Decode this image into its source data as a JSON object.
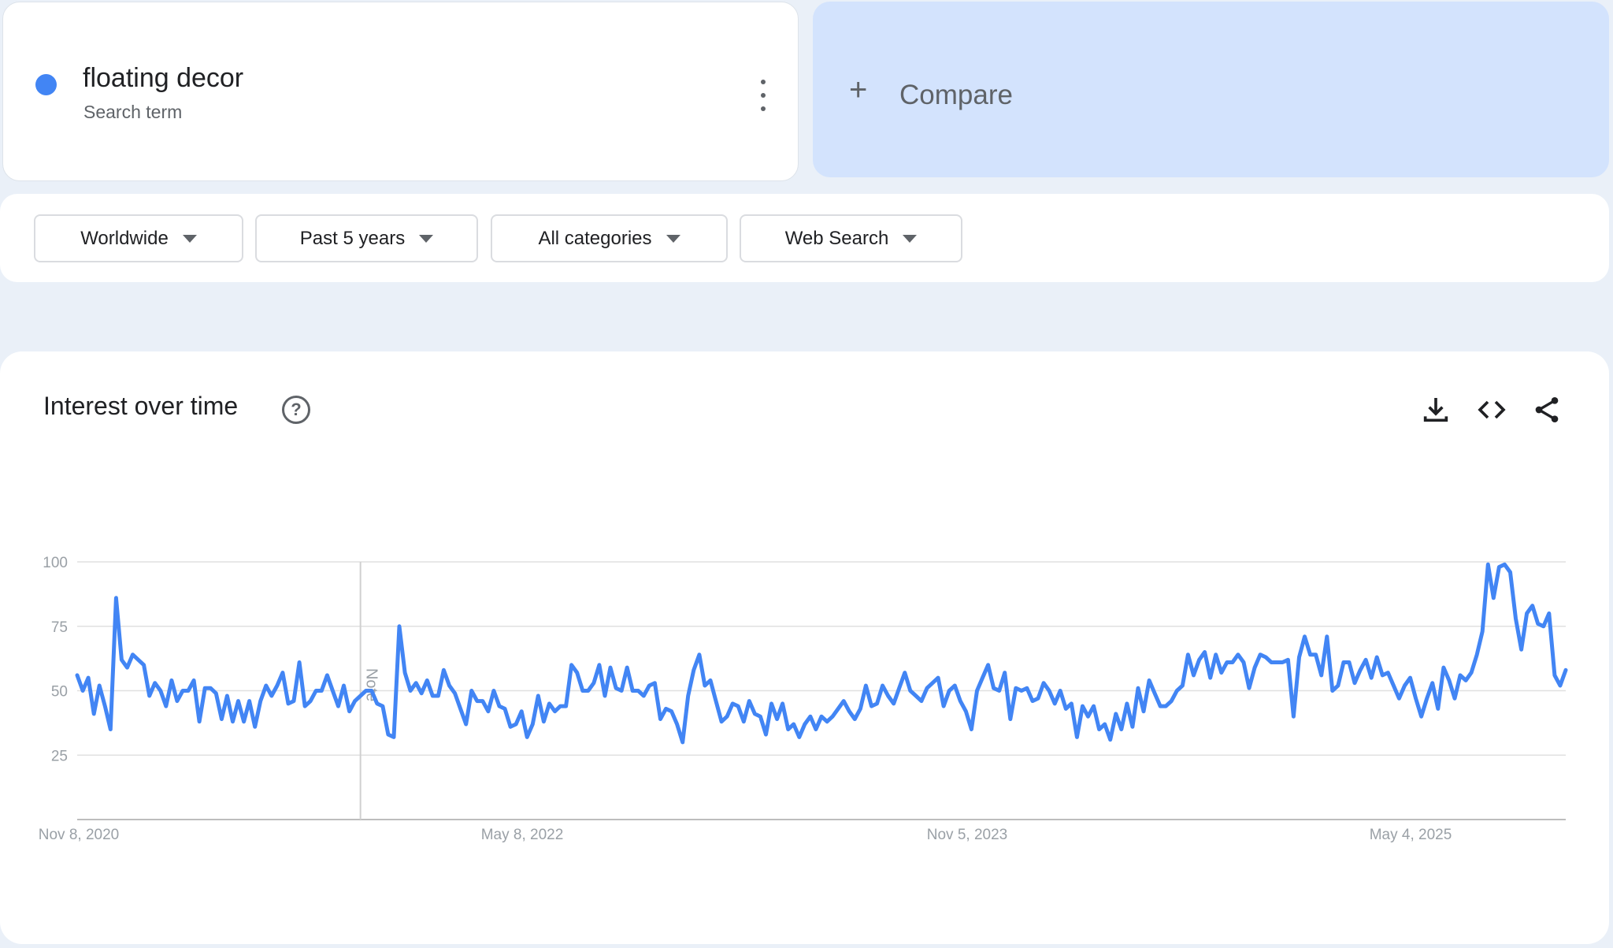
{
  "search_term": {
    "name": "floating decor",
    "subtitle": "Search term",
    "color": "#4285f4"
  },
  "compare": {
    "plus": "+",
    "label": "Compare"
  },
  "filters": [
    {
      "label": "Worldwide"
    },
    {
      "label": "Past 5 years"
    },
    {
      "label": "All categories"
    },
    {
      "label": "Web Search"
    }
  ],
  "chart": {
    "title": "Interest over time",
    "help_icon": "?",
    "actions": [
      "download-icon",
      "embed-code-icon",
      "share-icon"
    ],
    "note_label": "Note"
  },
  "chart_data": {
    "type": "line",
    "title": "Interest over time",
    "xlabel": "",
    "ylabel": "",
    "ylim": [
      0,
      100
    ],
    "yticks": [
      25,
      50,
      75,
      100
    ],
    "xticks": [
      "Nov 8, 2020",
      "May 8, 2022",
      "Nov 5, 2023",
      "May 4, 2025"
    ],
    "x_start": "Nov 8, 2020",
    "interval": "weekly",
    "note_index": 51,
    "grid": true,
    "line_color": "#4285f4",
    "series": [
      {
        "name": "floating decor",
        "values": [
          56,
          50,
          55,
          41,
          52,
          44,
          35,
          86,
          62,
          59,
          64,
          62,
          60,
          48,
          53,
          50,
          44,
          54,
          46,
          50,
          50,
          54,
          38,
          51,
          51,
          49,
          39,
          48,
          38,
          46,
          38,
          46,
          36,
          46,
          52,
          48,
          52,
          57,
          45,
          46,
          61,
          44,
          46,
          50,
          50,
          56,
          50,
          44,
          52,
          42,
          46,
          48,
          50,
          50,
          45,
          44,
          33,
          32,
          75,
          57,
          50,
          53,
          49,
          54,
          48,
          48,
          58,
          52,
          49,
          43,
          37,
          50,
          46,
          46,
          42,
          50,
          44,
          43,
          36,
          37,
          42,
          32,
          37,
          48,
          38,
          45,
          42,
          44,
          44,
          60,
          57,
          50,
          50,
          53,
          60,
          48,
          59,
          51,
          50,
          59,
          50,
          50,
          48,
          52,
          53,
          39,
          43,
          42,
          37,
          30,
          48,
          58,
          64,
          52,
          54,
          46,
          38,
          40,
          45,
          44,
          38,
          46,
          41,
          40,
          33,
          45,
          39,
          45,
          35,
          37,
          32,
          37,
          40,
          35,
          40,
          38,
          40,
          43,
          46,
          42,
          39,
          43,
          52,
          44,
          45,
          52,
          48,
          45,
          51,
          57,
          50,
          48,
          46,
          51,
          53,
          55,
          44,
          50,
          52,
          46,
          42,
          35,
          50,
          55,
          60,
          51,
          50,
          57,
          39,
          51,
          50,
          51,
          46,
          47,
          53,
          50,
          45,
          50,
          43,
          45,
          32,
          44,
          40,
          44,
          35,
          37,
          31,
          41,
          35,
          45,
          36,
          51,
          42,
          54,
          49,
          44,
          44,
          46,
          50,
          52,
          64,
          56,
          62,
          65,
          55,
          64,
          57,
          61,
          61,
          64,
          61,
          51,
          59,
          64,
          63,
          61,
          61,
          61,
          62,
          40,
          63,
          71,
          64,
          64,
          56,
          71,
          50,
          52,
          61,
          61,
          53,
          58,
          62,
          55,
          63,
          56,
          57,
          52,
          47,
          52,
          55,
          47,
          40,
          47,
          53,
          43,
          59,
          54,
          47,
          56,
          54,
          57,
          64,
          73,
          99,
          86,
          98,
          99,
          96,
          78,
          66,
          80,
          83,
          76,
          75,
          80,
          56,
          52,
          58
        ]
      }
    ]
  }
}
